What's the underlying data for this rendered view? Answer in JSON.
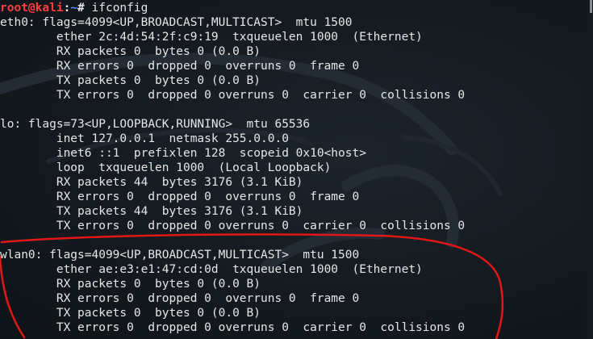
{
  "terminal": {
    "prompt": {
      "user_host": "root@kali",
      "separator": ":",
      "path": "~",
      "symbol": "# ",
      "command": "ifconfig"
    },
    "output": [
      "eth0: flags=4099<UP,BROADCAST,MULTICAST>  mtu 1500",
      "        ether 2c:4d:54:2f:c9:19  txqueuelen 1000  (Ethernet)",
      "        RX packets 0  bytes 0 (0.0 B)",
      "        RX errors 0  dropped 0  overruns 0  frame 0",
      "        TX packets 0  bytes 0 (0.0 B)",
      "        TX errors 0  dropped 0 overruns 0  carrier 0  collisions 0",
      "",
      "lo: flags=73<UP,LOOPBACK,RUNNING>  mtu 65536",
      "        inet 127.0.0.1  netmask 255.0.0.0",
      "        inet6 ::1  prefixlen 128  scopeid 0x10<host>",
      "        loop  txqueuelen 1000  (Local Loopback)",
      "        RX packets 44  bytes 3176 (3.1 KiB)",
      "        RX errors 0  dropped 0  overruns 0  frame 0",
      "        TX packets 44  bytes 3176 (3.1 KiB)",
      "        TX errors 0  dropped 0 overruns 0  carrier 0  collisions 0",
      "",
      "wlan0: flags=4099<UP,BROADCAST,MULTICAST>  mtu 1500",
      "        ether ae:e3:e1:47:cd:0d  txqueuelen 1000  (Ethernet)",
      "        RX packets 0  bytes 0 (0.0 B)",
      "        RX errors 0  dropped 0  overruns 0  frame 0",
      "        TX packets 0  bytes 0 (0.0 B)",
      "        TX errors 0  dropped 0 overruns 0  carrier 0  collisions 0"
    ]
  },
  "colors": {
    "background": "#141a20",
    "text": "#e6e6e6",
    "prompt_user": "#ff3f3f",
    "prompt_path": "#4f8cff",
    "annotation": "#e01818"
  }
}
